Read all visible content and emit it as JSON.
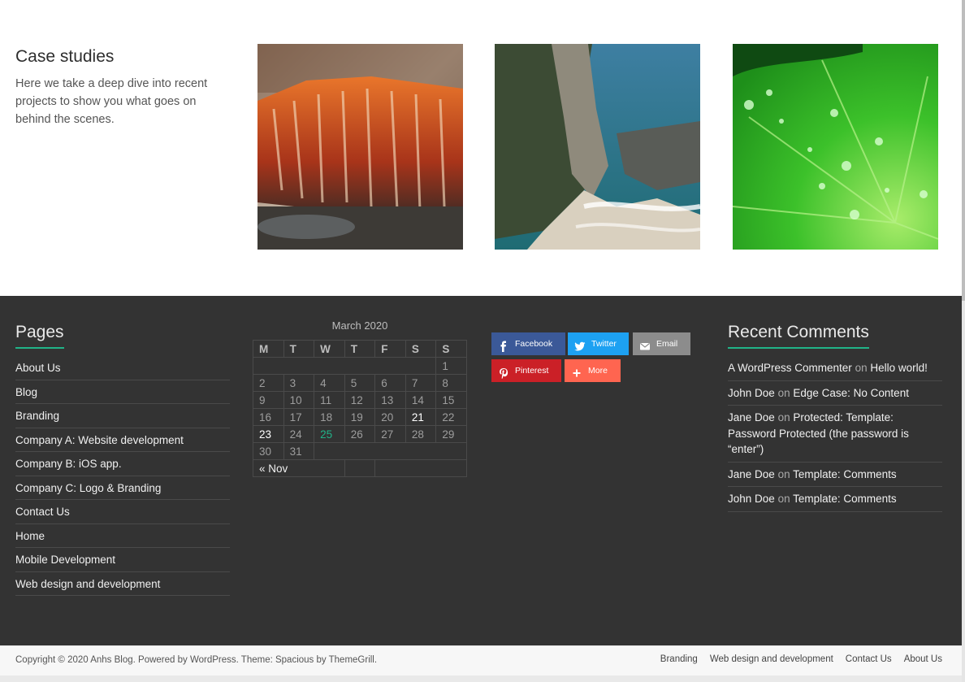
{
  "case_studies": {
    "title": "Case studies",
    "description": "Here we take a deep dive into recent projects to show you what goes on behind the scenes."
  },
  "pages_widget": {
    "title": "Pages",
    "items": [
      "About Us",
      "Blog",
      "Branding",
      "Company A: Website development",
      "Company B: iOS app.",
      "Company C: Logo & Branding",
      "Contact Us",
      "Home",
      "Mobile Development",
      "Web design and development"
    ]
  },
  "calendar": {
    "caption": "March 2020",
    "weekdays": [
      "M",
      "T",
      "W",
      "T",
      "F",
      "S",
      "S"
    ],
    "prev_link": "« Nov"
  },
  "share": {
    "facebook": "Facebook",
    "twitter": "Twitter",
    "email": "Email",
    "pinterest": "Pinterest",
    "more": "More"
  },
  "recent_comments": {
    "title": "Recent Comments",
    "on_word": "on",
    "items": [
      {
        "author": "A WordPress Commenter",
        "post": "Hello world!"
      },
      {
        "author": "John Doe",
        "post": "Edge Case: No Content"
      },
      {
        "author": "Jane Doe",
        "post": "Protected: Template: Password Protected (the password is “enter”)"
      },
      {
        "author": "Jane Doe",
        "post": "Template: Comments"
      },
      {
        "author": "John Doe",
        "post": "Template: Comments"
      }
    ]
  },
  "footer": {
    "copyright": "Copyright © 2020 Anhs Blog. Powered by WordPress. Theme: Spacious by ThemeGrill.",
    "nav": [
      "Branding",
      "Web design and development",
      "Contact Us",
      "About Us"
    ]
  },
  "colors": {
    "accent": "#21b388",
    "footer_bg": "#333333",
    "facebook": "#3b5998",
    "twitter": "#1da1f2",
    "email": "#8c8c8c",
    "pinterest": "#cb2027",
    "more": "#ff6550"
  }
}
